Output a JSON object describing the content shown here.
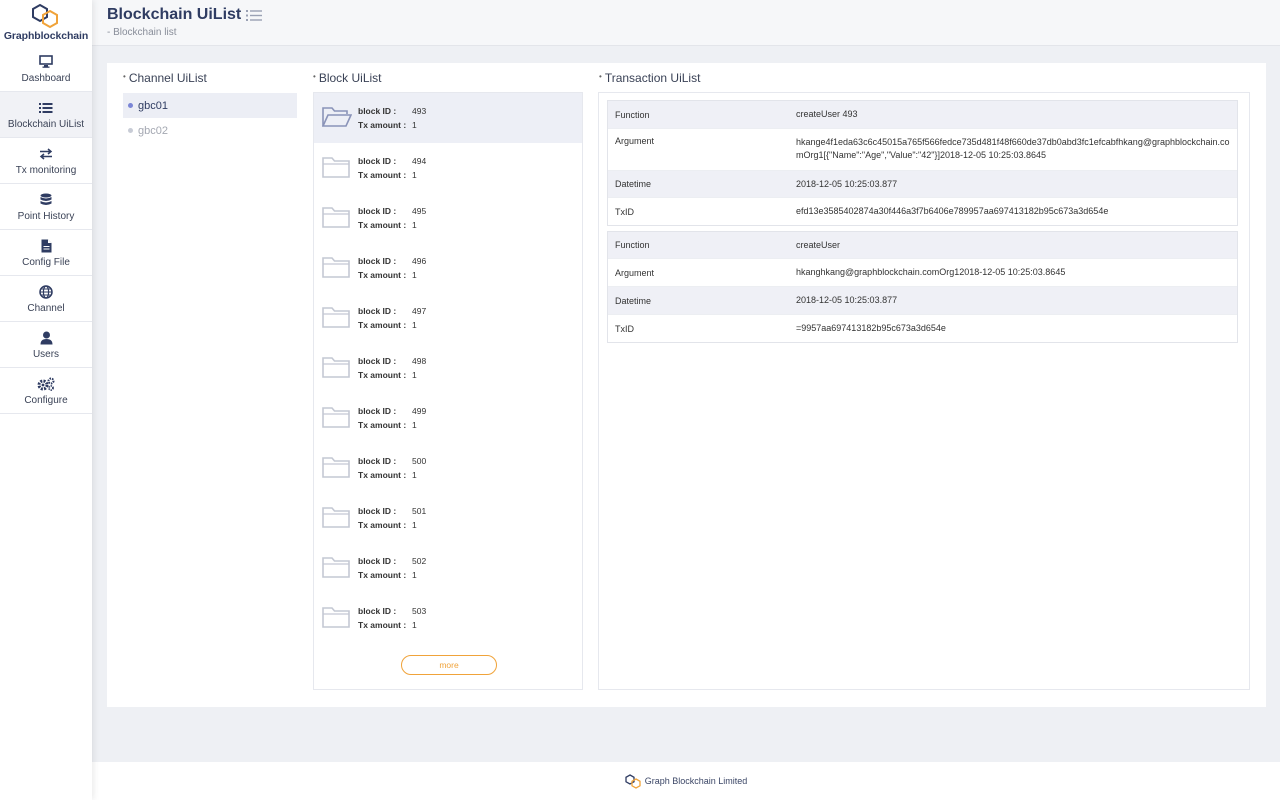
{
  "app": {
    "name": "Graphblockchain"
  },
  "sidebar": {
    "items": [
      {
        "label": "Dashboard",
        "icon": "monitor-icon"
      },
      {
        "label": "Blockchain UiList",
        "icon": "list-icon"
      },
      {
        "label": "Tx monitoring",
        "icon": "exchange-icon"
      },
      {
        "label": "Point History",
        "icon": "database-icon"
      },
      {
        "label": "Config File",
        "icon": "file-icon"
      },
      {
        "label": "Channel",
        "icon": "globe-icon"
      },
      {
        "label": "Users",
        "icon": "user-icon"
      },
      {
        "label": "Configure",
        "icon": "cogs-icon"
      }
    ]
  },
  "header": {
    "title": "Blockchain UiList",
    "subtitle": "- Blockchain list"
  },
  "channel": {
    "title": "Channel UiList",
    "items": [
      {
        "label": "gbc01"
      },
      {
        "label": "gbc02"
      }
    ]
  },
  "blocks": {
    "title": "Block UiList",
    "id_label": "block ID :",
    "amount_label": "Tx amount :",
    "items": [
      {
        "id": "493",
        "amount": "1"
      },
      {
        "id": "494",
        "amount": "1"
      },
      {
        "id": "495",
        "amount": "1"
      },
      {
        "id": "496",
        "amount": "1"
      },
      {
        "id": "497",
        "amount": "1"
      },
      {
        "id": "498",
        "amount": "1"
      },
      {
        "id": "499",
        "amount": "1"
      },
      {
        "id": "500",
        "amount": "1"
      },
      {
        "id": "501",
        "amount": "1"
      },
      {
        "id": "502",
        "amount": "1"
      },
      {
        "id": "503",
        "amount": "1"
      }
    ],
    "more_label": "more"
  },
  "transactions": {
    "title": "Transaction UiList",
    "labels": {
      "function": "Function",
      "argument": "Argument",
      "datetime": "Datetime",
      "txid": "TxID"
    },
    "items": [
      {
        "function": "createUser 493",
        "argument": "hkange4f1eda63c6c45015a765f566fedce735d481f48f660de37db0abd3fc1efcabfhkang@graphblockchain.comOrg1[{\"Name\":\"Age\",\"Value\":\"42\"}]2018-12-05 10:25:03.8645",
        "datetime": "2018-12-05 10:25:03.877",
        "txid": "efd13e3585402874a30f446a3f7b6406e789957aa697413182b95c673a3d654e"
      },
      {
        "function": "createUser",
        "argument": "hkanghkang@graphblockchain.comOrg12018-12-05 10:25:03.8645",
        "datetime": "2018-12-05 10:25:03.877",
        "txid": "=9957aa697413182b95c673a3d654e"
      }
    ]
  },
  "footer": {
    "text": "Graph Blockchain Limited"
  },
  "colors": {
    "navy": "#2f3c62",
    "accent": "#f0a33a",
    "active_dot": "#7b86d6",
    "inactive_dot": "#c8ccd6"
  }
}
